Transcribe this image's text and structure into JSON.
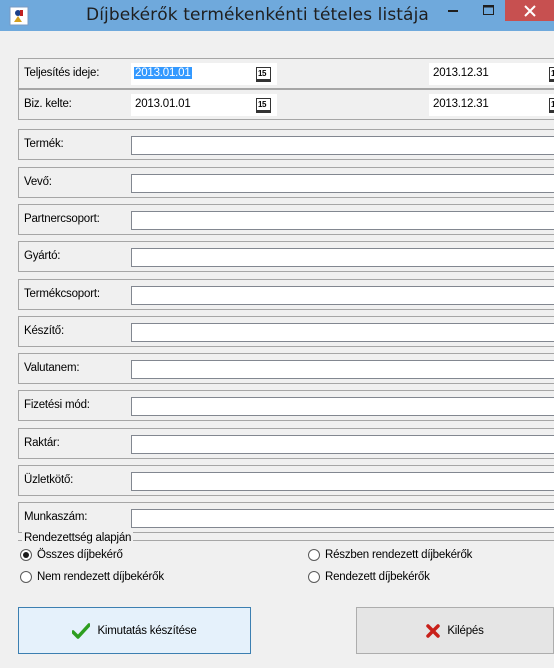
{
  "window": {
    "title": "Díjbekérők termékenkénti tételes listája",
    "minimize_glyph": "–",
    "close_glyph": "✕"
  },
  "dates": {
    "teljesites": {
      "label": "Teljesítés ideje:",
      "from": "2013.01.01",
      "to": "2013.12.31"
    },
    "biz_kelte": {
      "label": "Biz. kelte:",
      "from": "2013.01.01",
      "to": "2013.12.31"
    },
    "calendar_glyph": "15"
  },
  "filters": [
    {
      "label": "Termék:",
      "value": ""
    },
    {
      "label": "Vevő:",
      "value": ""
    },
    {
      "label": "Partnercsoport:",
      "value": ""
    },
    {
      "label": "Gyártó:",
      "value": ""
    },
    {
      "label": "Termékcsoport:",
      "value": ""
    },
    {
      "label": "Készítő:",
      "value": ""
    },
    {
      "label": "Valutanem:",
      "value": ""
    },
    {
      "label": "Fizetési mód:",
      "value": ""
    },
    {
      "label": "Raktár:",
      "value": ""
    },
    {
      "label": "Üzletkötő:",
      "value": ""
    },
    {
      "label": "Munkaszám:",
      "value": ""
    }
  ],
  "sort_group": {
    "legend": "Rendezettség alapján",
    "options": [
      {
        "label": "Összes díjbekérő",
        "checked": true
      },
      {
        "label": "Részben rendezett díjbekérők",
        "checked": false
      },
      {
        "label": "Nem rendezett díjbekérők",
        "checked": false
      },
      {
        "label": "Rendezett díjbekérők",
        "checked": false
      }
    ]
  },
  "buttons": {
    "report": "Kimutatás készítése",
    "exit": "Kilépés"
  },
  "colors": {
    "titlebar": "#6fa9dc",
    "close_button": "#c75050",
    "selection": "#3399ff",
    "check_icon": "#2e9e1f",
    "exit_icon": "#c8201a"
  }
}
